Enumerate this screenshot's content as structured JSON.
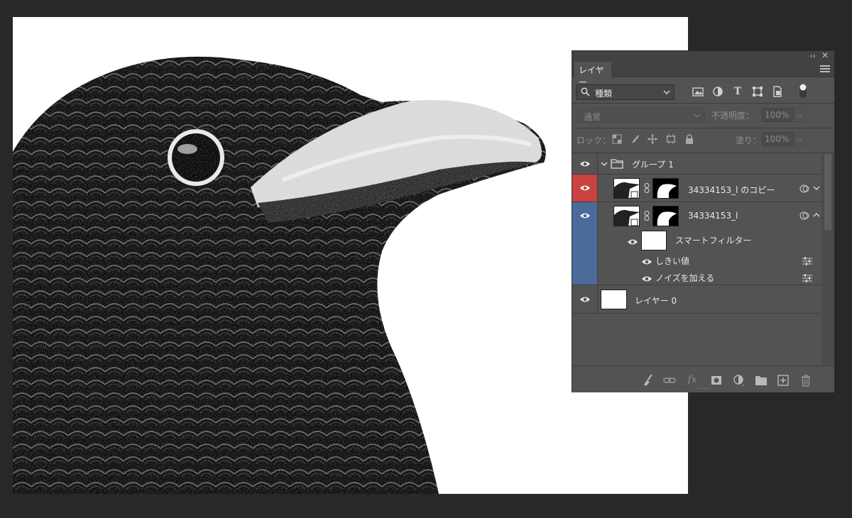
{
  "panel": {
    "tab_label": "レイヤー",
    "collapse_glyph": "‹‹",
    "close_glyph": "✕",
    "filter": {
      "kind_label": "種類",
      "icons": [
        "image-filter-icon",
        "adjustment-filter-icon",
        "type-filter-icon",
        "shape-filter-icon",
        "smart-object-filter-icon"
      ],
      "type_glyph": "T"
    },
    "blend": {
      "mode": "通常",
      "opacity_label": "不透明度：",
      "opacity_value": "100%"
    },
    "lock": {
      "label": "ロック：",
      "fill_label": "塗り：",
      "fill_value": "100%"
    },
    "layers": [
      {
        "name": "グループ 1",
        "type": "group",
        "expanded": true,
        "eye_color": ""
      },
      {
        "name": "34334153_l のコピー",
        "type": "smart-object",
        "eye_color": "#c8433f"
      },
      {
        "name": "34334153_l",
        "type": "smart-object",
        "eye_color": "#4a6a9a"
      },
      {
        "name": "スマートフィルター",
        "type": "smart-filter-mask"
      },
      {
        "name": "しきい値",
        "type": "filter"
      },
      {
        "name": "ノイズを加える",
        "type": "filter"
      },
      {
        "name": "レイヤー 0",
        "type": "pixel"
      }
    ],
    "bottom_icons": [
      "brush-cleanup-icon",
      "link-layers-icon",
      "fx-icon",
      "add-mask-icon",
      "adjustment-layer-icon",
      "new-group-icon",
      "new-layer-icon",
      "trash-icon"
    ],
    "fx_glyph": "fx"
  },
  "colors": {
    "workspace": "#282828",
    "panel": "#535353",
    "red_label": "#c8433f",
    "blue_label": "#4a6a9a"
  }
}
